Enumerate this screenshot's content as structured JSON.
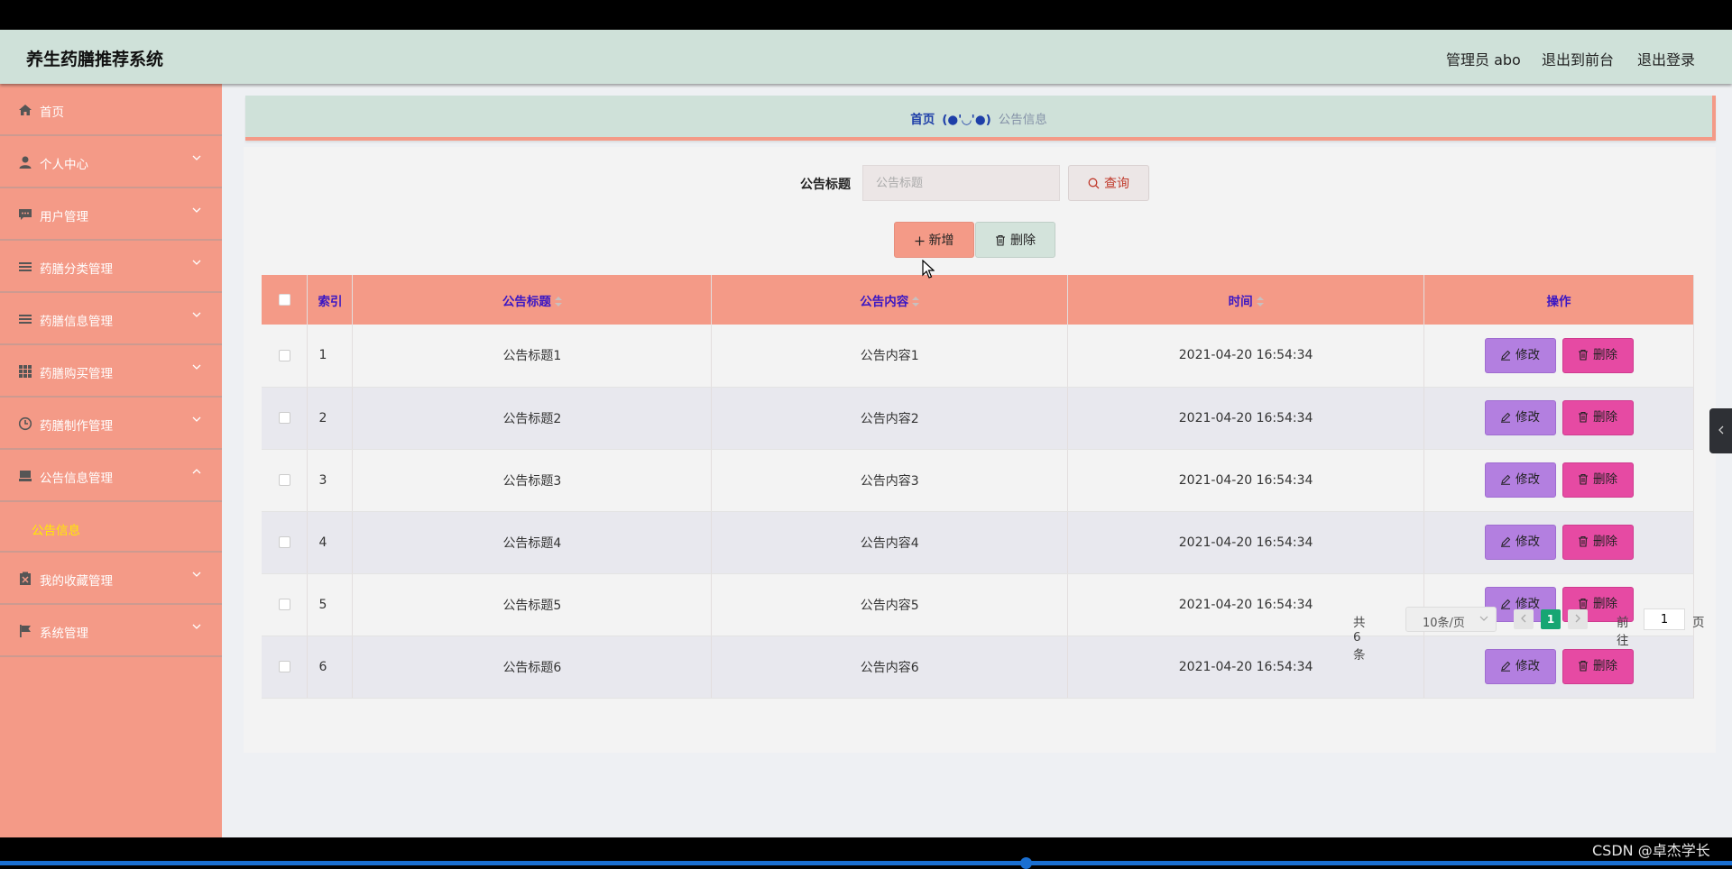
{
  "header": {
    "app_title": "养生药膳推荐系统",
    "user": "管理员 abo",
    "back_to_front": "退出到前台",
    "logout": "退出登录"
  },
  "sidebar": {
    "items": [
      {
        "label": "首页",
        "icon": "home-icon"
      },
      {
        "label": "个人中心",
        "icon": "user-icon"
      },
      {
        "label": "用户管理",
        "icon": "chat-icon"
      },
      {
        "label": "药膳分类管理",
        "icon": "list-icon"
      },
      {
        "label": "药膳信息管理",
        "icon": "list-icon"
      },
      {
        "label": "药膳购买管理",
        "icon": "grid-icon"
      },
      {
        "label": "药膳制作管理",
        "icon": "clock-icon"
      },
      {
        "label": "公告信息管理",
        "icon": "notice-icon"
      },
      {
        "label": "我的收藏管理",
        "icon": "clipboard-icon"
      },
      {
        "label": "系统管理",
        "icon": "flag-icon"
      }
    ],
    "active_sub": "公告信息",
    "active_sub_color": "#ffea00"
  },
  "breadcrumb": {
    "home": "首页",
    "separator": "(●'◡'●)",
    "current": "公告信息"
  },
  "search": {
    "label": "公告标题",
    "placeholder": "公告标题",
    "value": "",
    "button": "查询"
  },
  "actions": {
    "add": "新增",
    "delete": "删除"
  },
  "table": {
    "columns": [
      "索引",
      "公告标题",
      "公告内容",
      "时间",
      "操作"
    ],
    "rows": [
      {
        "index": "1",
        "title": "公告标题1",
        "content": "公告内容1",
        "time": "2021-04-20 16:54:34"
      },
      {
        "index": "2",
        "title": "公告标题2",
        "content": "公告内容2",
        "time": "2021-04-20 16:54:34"
      },
      {
        "index": "3",
        "title": "公告标题3",
        "content": "公告内容3",
        "time": "2021-04-20 16:54:34"
      },
      {
        "index": "4",
        "title": "公告标题4",
        "content": "公告内容4",
        "time": "2021-04-20 16:54:34"
      },
      {
        "index": "5",
        "title": "公告标题5",
        "content": "公告内容5",
        "time": "2021-04-20 16:54:34"
      },
      {
        "index": "6",
        "title": "公告标题6",
        "content": "公告内容6",
        "time": "2021-04-20 16:54:34"
      }
    ],
    "edit_label": "修改",
    "delete_label": "删除"
  },
  "pagination": {
    "total": "共 6 条",
    "page_size": "10条/页",
    "current_page": "1",
    "goto_prefix": "前往",
    "goto_value": "1",
    "goto_suffix": "页"
  },
  "watermark": "CSDN @卓杰学长",
  "colors": {
    "header_bg": "#cfe1d9",
    "sidebar_bg": "#f49a87",
    "table_header_bg": "#f49a87",
    "edit_button": "#b37fe0",
    "delete_button": "#e64aa3",
    "page_active": "#17a673"
  }
}
